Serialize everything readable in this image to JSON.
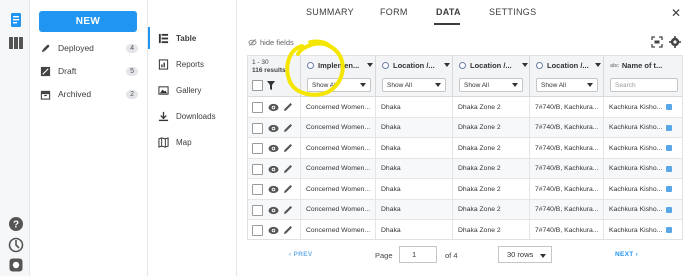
{
  "colors": {
    "accent": "#2095f2",
    "rail_bg": "#f6f7f9",
    "header_bg": "#f3f4f6",
    "annotation": "#f5e600",
    "link_disabled": "#6fb0ea"
  },
  "rail": {
    "icons": [
      "forms-icon",
      "library-icon",
      "help-icon",
      "support-icon",
      "github-icon"
    ]
  },
  "projects": {
    "new_label": "NEW",
    "items": [
      {
        "label": "Deployed",
        "count": "4",
        "icon": "rocket-icon"
      },
      {
        "label": "Draft",
        "count": "5",
        "icon": "draft-icon"
      },
      {
        "label": "Archived",
        "count": "2",
        "icon": "archive-icon"
      }
    ]
  },
  "subnav": {
    "items": [
      {
        "label": "Table",
        "icon": "table-icon",
        "active": true
      },
      {
        "label": "Reports",
        "icon": "reports-icon"
      },
      {
        "label": "Gallery",
        "icon": "gallery-icon"
      },
      {
        "label": "Downloads",
        "icon": "download-icon"
      },
      {
        "label": "Map",
        "icon": "map-icon"
      }
    ]
  },
  "tabs": {
    "summary": "SUMMARY",
    "form": "FORM",
    "data": "DATA",
    "settings": "SETTINGS",
    "active": "DATA"
  },
  "toolbar": {
    "hide_fields": "hide fields"
  },
  "table": {
    "range": "1 - 30",
    "results": "116 results",
    "columns": [
      {
        "title": "Implemen...",
        "filter": "Show All",
        "type": "select"
      },
      {
        "title": "Location /...",
        "filter": "Show All",
        "type": "select"
      },
      {
        "title": "Location /...",
        "filter": "Show All",
        "type": "select"
      },
      {
        "title": "Location /...",
        "filter": "Show All",
        "type": "select"
      },
      {
        "title": "Name of t...",
        "filter": "Search",
        "type": "text"
      }
    ],
    "rows": [
      [
        "Concerned Women...",
        "Dhaka",
        "Dhaka Zone 2",
        "7#740/B, Kachkura...",
        "Kachkura Kisho..."
      ],
      [
        "Concerned Women...",
        "Dhaka",
        "Dhaka Zone 2",
        "7#740/B, Kachkura...",
        "Kachkura Kisho..."
      ],
      [
        "Concerned Women...",
        "Dhaka",
        "Dhaka Zone 2",
        "7#740/B, Kachkura...",
        "Kachkura Kisho..."
      ],
      [
        "Concerned Women...",
        "Dhaka",
        "Dhaka Zone 2",
        "7#740/B, Kachkura...",
        "Kachkura Kisho..."
      ],
      [
        "Concerned Women...",
        "Dhaka",
        "Dhaka Zone 2",
        "7#740/B, Kachkura...",
        "Kachkura Kisho..."
      ],
      [
        "Concerned Women...",
        "Dhaka",
        "Dhaka Zone 2",
        "7#740/B, Kachkura...",
        "Kachkura Kisho..."
      ],
      [
        "Concerned Women...",
        "Dhaka",
        "Dhaka Zone 2",
        "7#740/B, Kachkura...",
        "Kachkura Kisho..."
      ]
    ]
  },
  "pagination": {
    "prev": "‹ PREV",
    "page_label": "Page",
    "current_page": "1",
    "of_label": "of 4",
    "rows_per_page": "30 rows",
    "next": "NEXT ›"
  }
}
